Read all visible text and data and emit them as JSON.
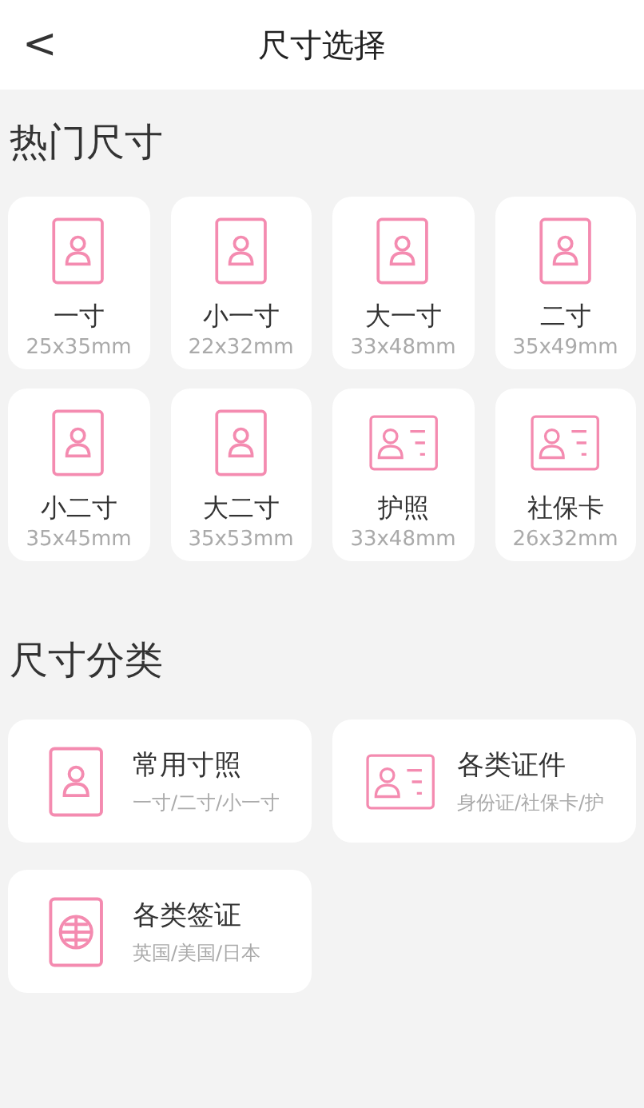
{
  "header": {
    "back": "<",
    "title": "尺寸选择"
  },
  "hot": {
    "heading": "热门尺寸",
    "items": [
      {
        "kind": "portrait",
        "name": "一寸",
        "size": "25x35mm"
      },
      {
        "kind": "portrait",
        "name": "小一寸",
        "size": "22x32mm"
      },
      {
        "kind": "portrait",
        "name": "大一寸",
        "size": "33x48mm"
      },
      {
        "kind": "portrait",
        "name": "二寸",
        "size": "35x49mm"
      },
      {
        "kind": "portrait",
        "name": "小二寸",
        "size": "35x45mm"
      },
      {
        "kind": "portrait",
        "name": "大二寸",
        "size": "35x53mm"
      },
      {
        "kind": "id_card",
        "name": "护照",
        "size": "33x48mm"
      },
      {
        "kind": "id_card",
        "name": "社保卡",
        "size": "26x32mm"
      }
    ]
  },
  "categories": {
    "heading": "尺寸分类",
    "items": [
      {
        "kind": "portrait",
        "name": "常用寸照",
        "desc": "一寸/二寸/小一寸"
      },
      {
        "kind": "id_card",
        "name": "各类证件",
        "desc": "身份证/社保卡/护"
      },
      {
        "kind": "globe",
        "name": "各类签证",
        "desc": "英国/美国/日本"
      }
    ]
  }
}
